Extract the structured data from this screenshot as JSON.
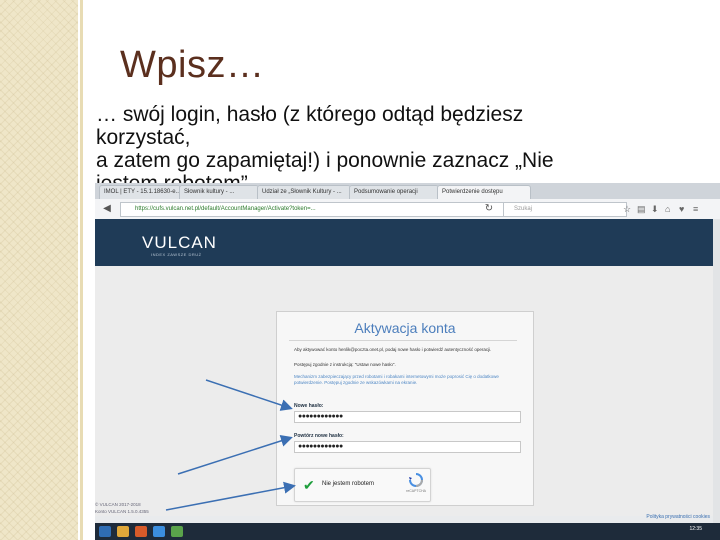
{
  "slide": {
    "title": "Wpisz…",
    "lines": [
      "… swój login, hasło (z którego odtąd będziesz",
      "korzystać,",
      "a zatem go zapamiętaj!) i ponownie zaznacz „Nie",
      "jestem robotem”"
    ]
  },
  "browser": {
    "tabs": [
      "IMOL | ETY - 15.1.18630-e...",
      "Słownik kultury - ...",
      "Udział ze „Słownik Kultury - ...",
      "Podsumowanie operacji",
      "Potwierdzenie dostępu"
    ],
    "url": "https://cufs.vulcan.net.pl/default/AccountManager/Activate?token=...",
    "search_placeholder": "Szukaj"
  },
  "site": {
    "logo": "VULCAN",
    "logo_sub": "INDEX ZAWSZE DRUŻ",
    "card": {
      "title": "Aktywacja konta",
      "intro": "Aby aktywować konto henlik@poczta.onet.pl, podaj nowe hasło i potwierdź autentyczność operacji.",
      "hint": "Postępuj zgodnie z instrukcją: \"Ustaw nowe hasło\".",
      "blue_note": "Mechanizm zabezpieczający przed robotami i robakami internetowymi może poprosić Cię o dodatkowe potwierdzenie. Postępuj zgodnie ze wskazówkami na ekranie.",
      "new_password_label": "Nowe hasło:",
      "new_password_value": "●●●●●●●●●●●●",
      "repeat_password_label": "Powtórz nowe hasło:",
      "repeat_password_value": "●●●●●●●●●●●●",
      "captcha_label": "Nie jestem robotem",
      "captcha_brand": "reCAPTCHA"
    },
    "footer_left": [
      "© VULCAN 2017-2018",
      "Konto VULCAN 1.5.0.4355"
    ],
    "footer_right": "Polityka prywatności cookies",
    "clock": "12:35"
  },
  "colors": {
    "title": "#5b2f1e",
    "navy": "#1f3b57",
    "card_title": "#4c7ebc",
    "arrow": "#3b6fb3"
  }
}
